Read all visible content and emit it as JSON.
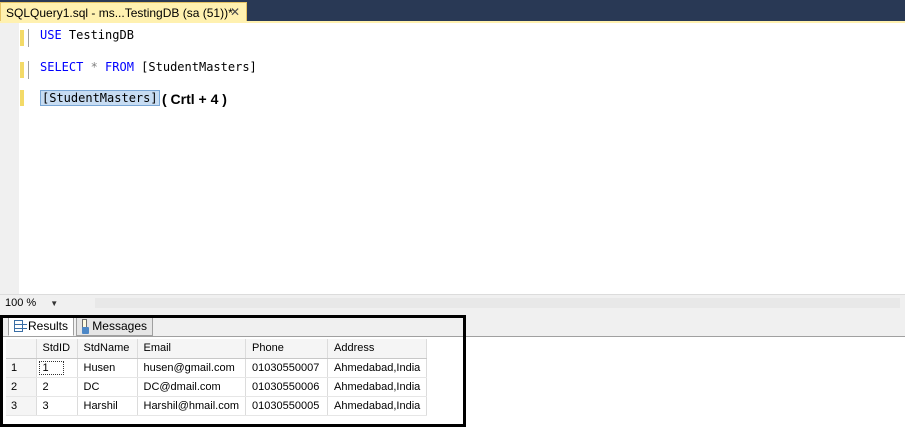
{
  "tab": {
    "title": "SQLQuery1.sql - ms...TestingDB (sa (51))*",
    "close_glyph": "✕"
  },
  "editor": {
    "line1_kw": "USE",
    "line1_rest": " TestingDB",
    "line2_kw": "SELECT",
    "line2_star": " * ",
    "line2_kw2": "FROM",
    "line2_rest": " [StudentMasters]",
    "line3_selected": "[StudentMasters]",
    "annotation": "( Crtl + 4 )"
  },
  "zoom": {
    "value": "100 %"
  },
  "results": {
    "tabs": [
      {
        "label": "Results",
        "icon": "grid-icon"
      },
      {
        "label": "Messages",
        "icon": "messages-icon"
      }
    ],
    "columns": [
      "StdID",
      "StdName",
      "Email",
      "Phone",
      "Address"
    ],
    "rows": [
      {
        "num": "1",
        "cells": [
          "1",
          "Husen",
          "husen@gmail.com",
          "01030550007",
          "Ahmedabad,India"
        ]
      },
      {
        "num": "2",
        "cells": [
          "2",
          "DC",
          "DC@dmail.com",
          "01030550006",
          "Ahmedabad,India"
        ]
      },
      {
        "num": "3",
        "cells": [
          "3",
          "Harshil",
          "Harshil@hmail.com",
          "01030550005",
          "Ahmedabad,India"
        ]
      }
    ]
  }
}
